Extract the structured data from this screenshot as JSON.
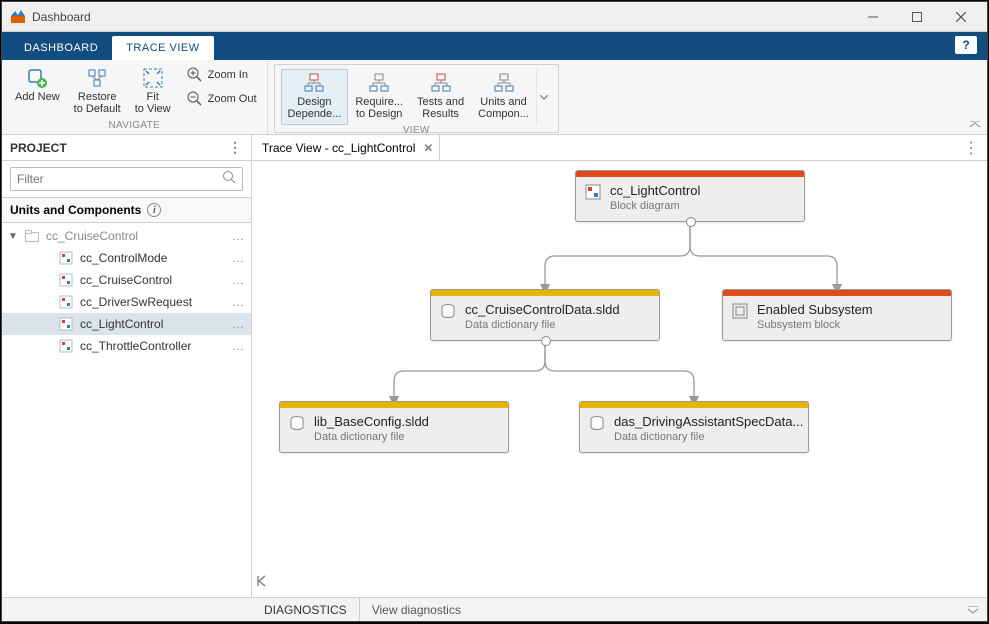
{
  "app": {
    "title": "Dashboard"
  },
  "tabs": {
    "dashboard": "DASHBOARD",
    "traceview": "TRACE VIEW"
  },
  "toolstrip": {
    "navigate": {
      "label": "NAVIGATE",
      "add_new": "Add New",
      "restore": "Restore\nto Default",
      "fit": "Fit\nto View",
      "zoom_in": "Zoom In",
      "zoom_out": "Zoom Out"
    },
    "view": {
      "label": "VIEW",
      "design": "Design\nDepende...",
      "require": "Require...\nto Design",
      "tests": "Tests and\nResults",
      "units": "Units and\nCompon..."
    }
  },
  "project": {
    "title": "PROJECT",
    "filter_placeholder": "Filter",
    "section": "Units and Components",
    "root": "cc_CruiseControl",
    "items": [
      {
        "name": "cc_ControlMode"
      },
      {
        "name": "cc_CruiseControl"
      },
      {
        "name": "cc_DriverSwRequest"
      },
      {
        "name": "cc_LightControl",
        "selected": true
      },
      {
        "name": "cc_ThrottleController"
      }
    ]
  },
  "doc": {
    "tab_title": "Trace View - cc_LightControl"
  },
  "nodes": {
    "light": {
      "title": "cc_LightControl",
      "sub": "Block diagram"
    },
    "ccd": {
      "title": "cc_CruiseControlData.sldd",
      "sub": "Data dictionary file"
    },
    "enabled": {
      "title": "Enabled Subsystem",
      "sub": "Subsystem block"
    },
    "base": {
      "title": "lib_BaseConfig.sldd",
      "sub": "Data dictionary file"
    },
    "das": {
      "title": "das_DrivingAssistantSpecData...",
      "sub": "Data dictionary file"
    }
  },
  "status": {
    "diagnostics": "DIAGNOSTICS",
    "view": "View diagnostics"
  }
}
